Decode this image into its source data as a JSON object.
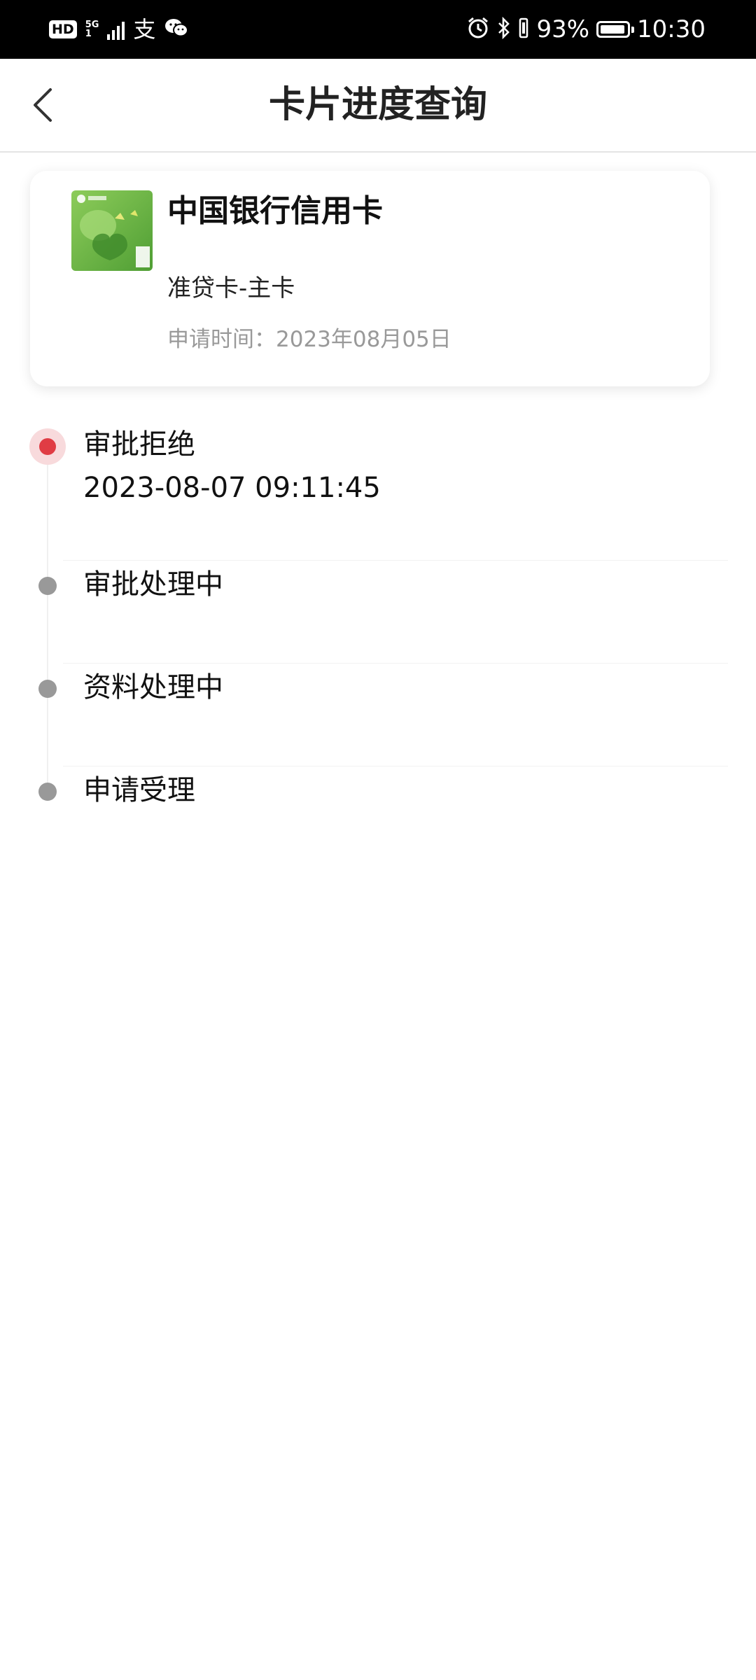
{
  "status_bar": {
    "hd": "HD",
    "network": "5G",
    "sim": "1",
    "alipay_glyph": "支",
    "battery": "93%",
    "time": "10:30",
    "icons": [
      "hd-icon",
      "signal-icon",
      "alipay-icon",
      "wechat-icon",
      "alarm-icon",
      "bluetooth-icon",
      "vibrate-icon",
      "battery-icon"
    ]
  },
  "nav": {
    "title": "卡片进度查询",
    "back_icon": "chevron-left-icon"
  },
  "card": {
    "name": "中国银行信用卡",
    "type": "准贷卡-主卡",
    "apply_date": "申请时间：2023年08月05日",
    "thumbnail_color": "#6ab347"
  },
  "timeline": {
    "active_color": "#e03c44",
    "inactive_color": "#999999",
    "items": [
      {
        "label": "审批拒绝",
        "time": "2023-08-07 09:11:45",
        "active": true
      },
      {
        "label": "审批处理中",
        "time": "",
        "active": false
      },
      {
        "label": "资料处理中",
        "time": "",
        "active": false
      },
      {
        "label": "申请受理",
        "time": "",
        "active": false
      }
    ]
  }
}
